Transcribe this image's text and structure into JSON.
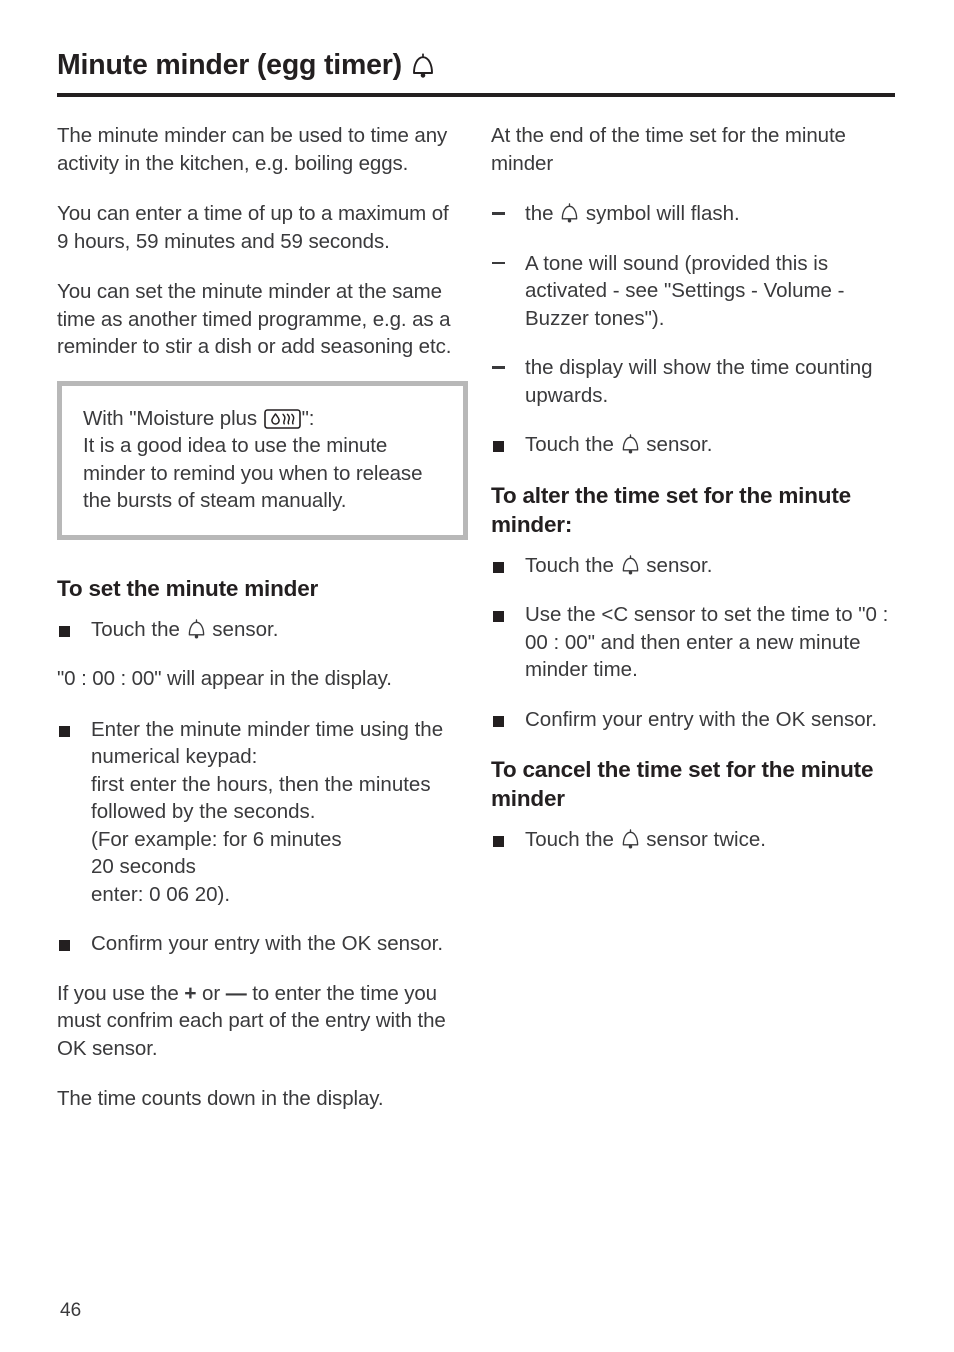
{
  "document": {
    "title": "Minute minder (egg timer)",
    "title_icon": "bell-icon",
    "page_number": "46"
  },
  "left_column": {
    "intro_paragraph": "The minute minder can be used to time any activity in the kitchen, e.g. boiling eggs.",
    "max_time_paragraph": "You can enter a time of up to a maximum of 9 hours, 59 minutes and 59 seconds.",
    "concurrent_paragraph": "You can set the minute minder at the same time as another timed programme, e.g. as a reminder to stir a dish or add seasoning etc.",
    "note_box": {
      "lead_prefix": "With \"Moisture plus ",
      "lead_icon": "moisture-plus-icon",
      "lead_suffix": "\":",
      "body": "It is a good idea to use the minute minder to remind you when to release the bursts of steam manually."
    },
    "set_section": {
      "heading": "To set the minute minder",
      "bullet_1_prefix": "Touch the ",
      "bullet_1_icon": "bell-icon",
      "bullet_1_suffix": " sensor.",
      "display_paragraph": "\"0 : 00 : 00\" will appear in the display.",
      "bullet_2": "Enter the minute minder time using the numerical keypad:\nfirst enter the hours, then the minutes followed by the seconds.\n(For example: for 6 minutes\n20 seconds\nenter: 0 06 20).",
      "bullet_3": "Confirm your entry with the OK sensor.",
      "plus_minus_prefix": "If you use the ",
      "plus_symbol": "+",
      "plus_minus_middle": " or ",
      "minus_symbol": "—",
      "plus_minus_suffix": " to enter the time you must confrim each part of the entry with the OK sensor.",
      "countdown_paragraph": "The time counts down in the display."
    }
  },
  "right_column": {
    "end_of_time": {
      "intro": "At the end of the time set for the minute minder",
      "dash_1_prefix": "the ",
      "dash_1_icon": "bell-icon",
      "dash_1_suffix": " symbol will flash.",
      "dash_2": "A tone will sound (provided this is activated - see \"Settings - Volume - Buzzer tones\").",
      "dash_3": "the display will show the time counting upwards.",
      "bullet_1_prefix": "Touch the ",
      "bullet_1_icon": "bell-icon",
      "bullet_1_suffix": " sensor."
    },
    "alter_section": {
      "heading": "To alter the time set for the minute minder:",
      "bullet_1_prefix": "Touch the ",
      "bullet_1_icon": "bell-icon",
      "bullet_1_suffix": " sensor.",
      "bullet_2": "Use the <C sensor to set the time to \"0 : 00 : 00\" and then enter a new minute minder time.",
      "bullet_3": "Confirm your entry with the OK sensor."
    },
    "cancel_section": {
      "heading": "To cancel the time set for the minute minder",
      "bullet_1_prefix": "Touch the ",
      "bullet_1_icon": "bell-icon",
      "bullet_1_suffix": " sensor twice."
    }
  },
  "colors": {
    "text": "#3a3a3c",
    "heading": "#231f20",
    "note_border": "#b8b8b8",
    "rule": "#231f20"
  }
}
